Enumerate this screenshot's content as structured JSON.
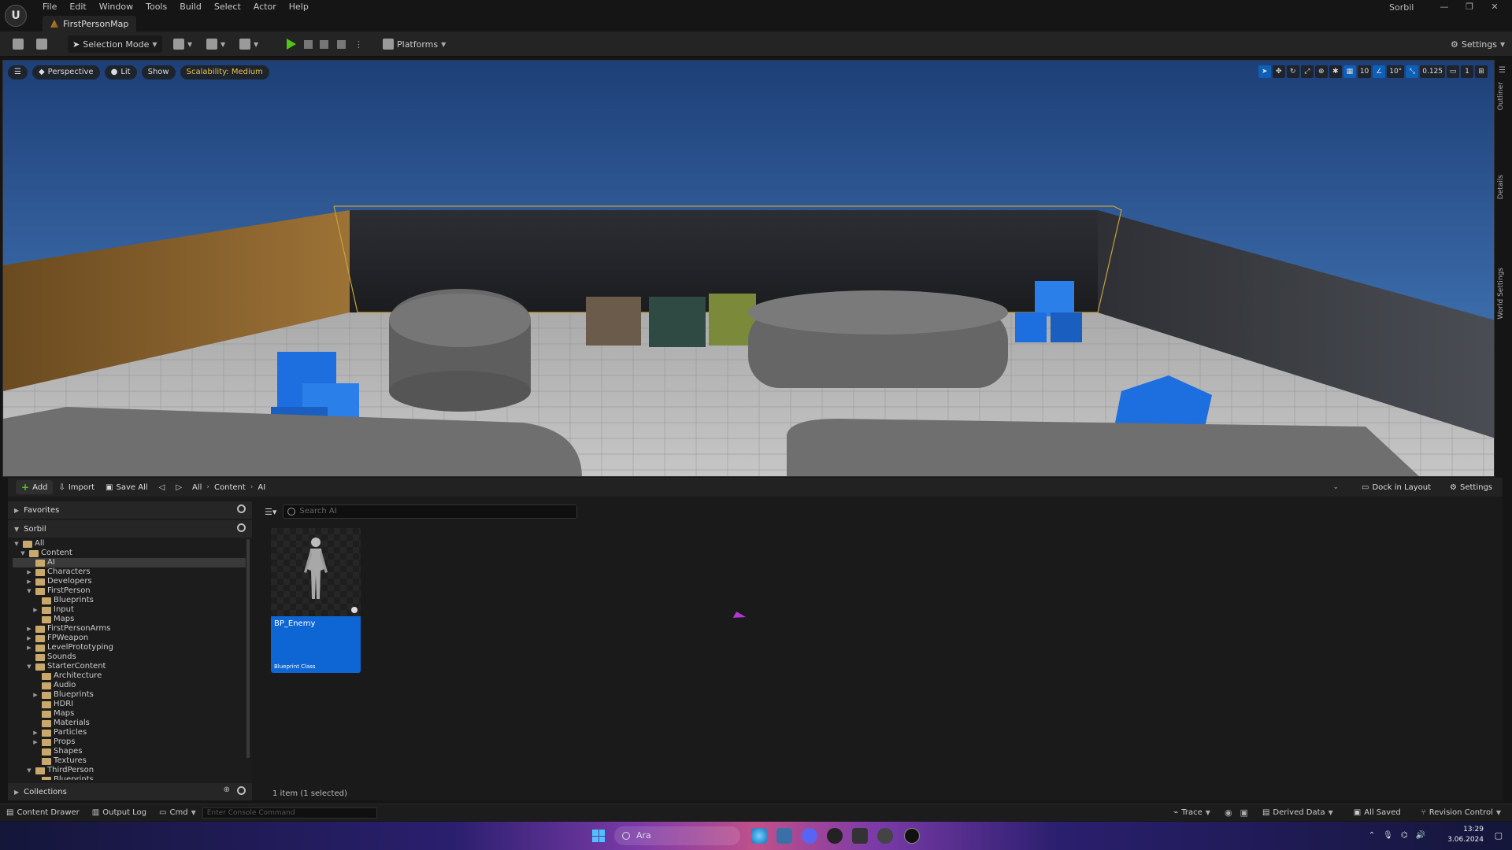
{
  "menu": [
    "File",
    "Edit",
    "Window",
    "Tools",
    "Build",
    "Select",
    "Actor",
    "Help"
  ],
  "document_tab": "FirstPersonMap",
  "user": "Sorbil",
  "toolbar": {
    "selection_mode": "Selection Mode",
    "platforms": "Platforms",
    "settings": "Settings"
  },
  "viewport": {
    "perspective": "Perspective",
    "lit": "Lit",
    "show": "Show",
    "scalability": "Scalability: Medium",
    "grid_snap": "10",
    "rot_snap": "10°",
    "scale_snap": "0.125",
    "camera_speed": "1"
  },
  "side_tabs": [
    "Outliner",
    "Details",
    "World Settings"
  ],
  "content_browser": {
    "add": "Add",
    "import": "Import",
    "save_all": "Save All",
    "breadcrumb": [
      "All",
      "Content",
      "AI"
    ],
    "dock_in_layout": "Dock in Layout",
    "settings": "Settings",
    "favorites": "Favorites",
    "project": "Sorbil",
    "collections": "Collections",
    "search_placeholder": "Search AI",
    "items_count": "1 item (1 selected)",
    "tree": [
      {
        "label": "All",
        "depth": 0,
        "open": true
      },
      {
        "label": "Content",
        "depth": 1,
        "open": true
      },
      {
        "label": "AI",
        "depth": 2,
        "open": false,
        "selected": true
      },
      {
        "label": "Characters",
        "depth": 2,
        "open": false,
        "collapsed": true
      },
      {
        "label": "Developers",
        "depth": 2,
        "open": false,
        "collapsed": true
      },
      {
        "label": "FirstPerson",
        "depth": 2,
        "open": true
      },
      {
        "label": "Blueprints",
        "depth": 3,
        "open": false
      },
      {
        "label": "Input",
        "depth": 3,
        "open": false,
        "collapsed": true
      },
      {
        "label": "Maps",
        "depth": 3,
        "open": false
      },
      {
        "label": "FirstPersonArms",
        "depth": 2,
        "open": false,
        "collapsed": true
      },
      {
        "label": "FPWeapon",
        "depth": 2,
        "open": false,
        "collapsed": true
      },
      {
        "label": "LevelPrototyping",
        "depth": 2,
        "open": false,
        "collapsed": true
      },
      {
        "label": "Sounds",
        "depth": 2,
        "open": false
      },
      {
        "label": "StarterContent",
        "depth": 2,
        "open": true
      },
      {
        "label": "Architecture",
        "depth": 3,
        "open": false
      },
      {
        "label": "Audio",
        "depth": 3,
        "open": false
      },
      {
        "label": "Blueprints",
        "depth": 3,
        "open": false,
        "collapsed": true
      },
      {
        "label": "HDRI",
        "depth": 3,
        "open": false
      },
      {
        "label": "Maps",
        "depth": 3,
        "open": false
      },
      {
        "label": "Materials",
        "depth": 3,
        "open": false
      },
      {
        "label": "Particles",
        "depth": 3,
        "open": false,
        "collapsed": true
      },
      {
        "label": "Props",
        "depth": 3,
        "open": false,
        "collapsed": true
      },
      {
        "label": "Shapes",
        "depth": 3,
        "open": false
      },
      {
        "label": "Textures",
        "depth": 3,
        "open": false
      },
      {
        "label": "ThirdPerson",
        "depth": 2,
        "open": true
      },
      {
        "label": "Blueprints",
        "depth": 3,
        "open": false
      }
    ],
    "asset": {
      "name": "BP_Enemy",
      "type": "Blueprint Class"
    }
  },
  "statusbar": {
    "content_drawer": "Content Drawer",
    "output_log": "Output Log",
    "cmd": "Cmd",
    "console_placeholder": "Enter Console Command",
    "trace": "Trace",
    "derived_data": "Derived Data",
    "all_saved": "All Saved",
    "revision_control": "Revision Control"
  },
  "taskbar": {
    "search": "Ara",
    "time": "13:29",
    "date": "3.06.2024"
  }
}
